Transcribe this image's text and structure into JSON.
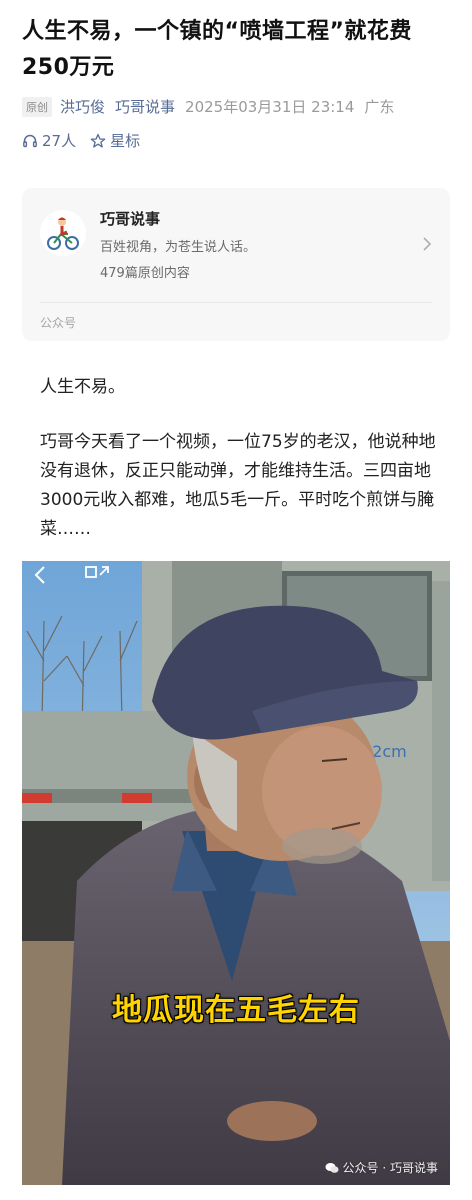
{
  "article": {
    "title": "人生不易，一个镇的“喷墙工程”就花费250万元",
    "original_badge": "原创",
    "author": "洪巧俊",
    "account": "巧哥说事",
    "datetime": "2025年03月31日 23:14",
    "location": "广东",
    "listeners": "27人",
    "star_label": "星标"
  },
  "account_card": {
    "name": "巧哥说事",
    "description": "百姓视角，为苍生说人话。",
    "article_count": "479篇原创内容",
    "footer": "公众号"
  },
  "body": {
    "paragraph1": "人生不易。",
    "paragraph2": "巧哥今天看了一个视频，一位75岁的老汉，他说种地没有退休，反正只能动弹，才能维持生活。三四亩地3000元收入都难，地瓜5毛一斤。平时吃个煎饼与腌菜……"
  },
  "image": {
    "caption": "地瓜现在五毛左右",
    "watermark": "公众号 · 巧哥说事",
    "truck_plate_fragment": "32cm"
  },
  "colors": {
    "link": "#576b95",
    "caption": "#ffd400",
    "meta_gray": "#9a9a9a"
  },
  "icons": [
    "headphones-icon",
    "star-outline-icon",
    "chevron-right-icon",
    "back-arrow-icon",
    "share-icon",
    "wechat-icon"
  ]
}
